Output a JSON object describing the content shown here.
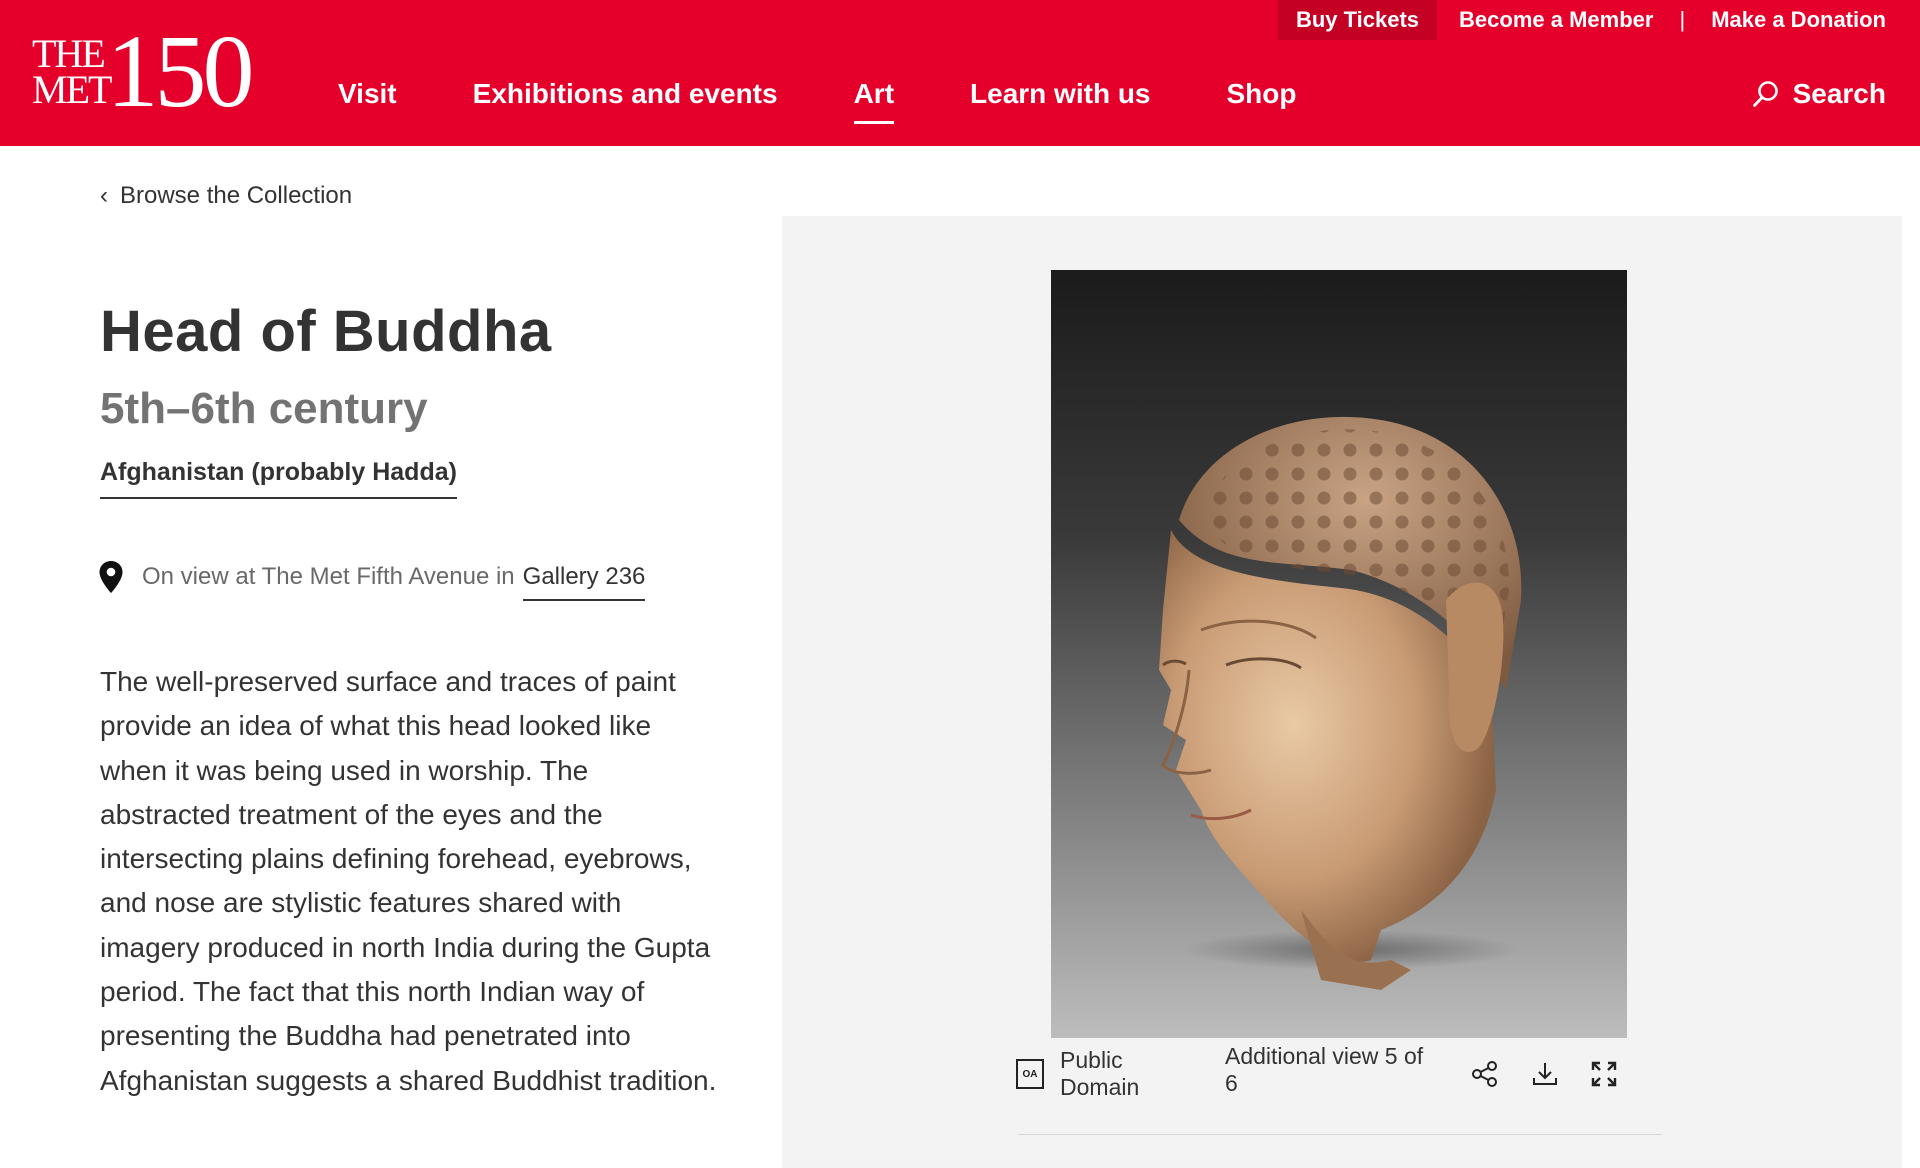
{
  "header": {
    "utility": {
      "buy_tickets": "Buy Tickets",
      "become_member": "Become a Member",
      "separator": "|",
      "make_donation": "Make a Donation"
    },
    "logo": {
      "line1": "THE",
      "line2": "MET",
      "number": "150"
    },
    "nav": [
      "Visit",
      "Exhibitions and events",
      "Art",
      "Learn with us",
      "Shop"
    ],
    "active_nav": "Art",
    "search_label": "Search"
  },
  "breadcrumb": {
    "label": "Browse the Collection"
  },
  "artwork": {
    "title": "Head of Buddha",
    "date": "5th–6th century",
    "place": "Afghanistan (probably Hadda)",
    "on_view_prefix": "On view at The Met Fifth Avenue in",
    "gallery": "Gallery 236",
    "description": "The well-preserved surface and traces of paint provide an idea of what this head looked like when it was being used in worship. The abstracted treatment of the eyes and the intersecting plains defining forehead, eyebrows, and nose are stylistic features shared with imagery produced in north India during the Gupta period. The fact that this north Indian way of presenting the Buddha had penetrated into Afghanistan suggests a shared Buddhist tradition."
  },
  "image_toolbar": {
    "oa_badge": "OA",
    "license": "Public Domain",
    "view_counter": "Additional view 5 of 6",
    "icons": [
      "share-icon",
      "download-icon",
      "expand-icon"
    ]
  },
  "colors": {
    "brand_red": "#e4002b",
    "panel_bg": "#f3f3f3",
    "text": "#333333",
    "muted": "#737373"
  }
}
